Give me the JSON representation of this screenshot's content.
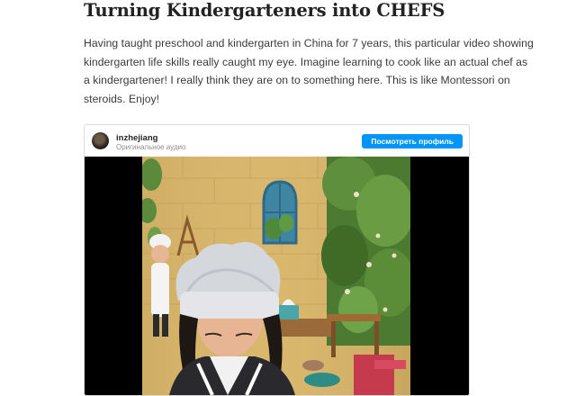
{
  "article": {
    "title": "Turning Kindergarteners into CHEFS",
    "intro": "Having taught preschool and kindergarten in China for 7 years, this particular video showing kindergarten life skills really caught my eye. Imagine learning to cook like an actual chef as a kindergartener! I really think they are on to something here. This is like Montessori on steroids. Enjoy!"
  },
  "embed": {
    "username": "inzhejiang",
    "sublabel": "Оригинальное аудио",
    "profile_button": "Посмотреть профиль"
  },
  "colors": {
    "button": "#0095f6",
    "wall": "#d9b86d",
    "window": "#3f86a4"
  }
}
